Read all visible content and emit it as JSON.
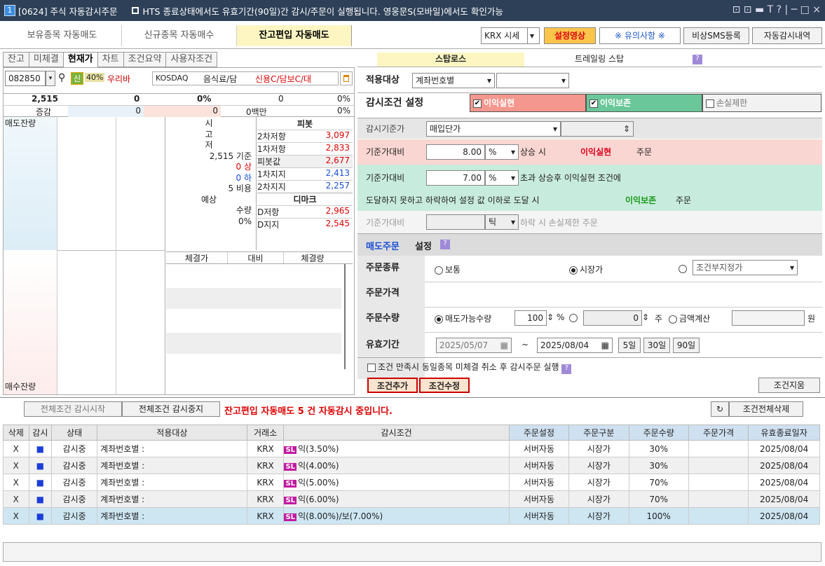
{
  "title": {
    "num": "1",
    "text": "[0624] 주식 자동감시주문",
    "notice": "HTS 종료상태에서도 유효기간(90일)간 감시/주문이 실행됩니다. 영웅문S(모바일)에서도 확인가능",
    "controls": "⊡ ⊡ ▬ T ? | ─ □ ×"
  },
  "toptabs": [
    "보유종목 자동매도",
    "신규종목 자동매수",
    "잔고편입 자동매도"
  ],
  "topright": {
    "market": "KRX 시세",
    "setting_video": "설정영상",
    "caution": "※ 유의사항 ※",
    "sms": "비상SMS등록",
    "history": "자동감시내역"
  },
  "lefttabs": [
    "잔고",
    "미체결",
    "현재가",
    "차트",
    "조건요약",
    "사용자조건"
  ],
  "stock": {
    "code": "082850",
    "badge": "신",
    "rate": "40%",
    "name": "우리바",
    "market": "KOSDAQ",
    "sector": "음식료/담",
    "credit": "신용C/담보C/대"
  },
  "quote": {
    "price": "2,515",
    "change_label": "증감",
    "v1": "0",
    "v2": "0%",
    "v3": "0",
    "v4": "0%",
    "r2a": "0",
    "r2b": "0",
    "r2c": "0백만",
    "r2d": "0%"
  },
  "orderbook": {
    "sell_label": "매도잔량",
    "buy_label": "매수잔량",
    "mid": [
      "시",
      "고",
      "저",
      "2,515 기준",
      "0 상",
      "0 하",
      "5 비용",
      "예상",
      "수량",
      "0%"
    ],
    "pivot_title": "피봇",
    "pivot": [
      [
        "2차저항",
        "3,097"
      ],
      [
        "1차저항",
        "2,833"
      ],
      [
        "피봇값",
        "2,677"
      ],
      [
        "1차지지",
        "2,413"
      ],
      [
        "2차지지",
        "2,257"
      ]
    ],
    "dimark_title": "디마크",
    "dimark": [
      [
        "D저항",
        "2,965"
      ],
      [
        "D지지",
        "2,545"
      ]
    ],
    "trade_cols": [
      "체결가",
      "대비",
      "체결량"
    ]
  },
  "righttabs": [
    "스탑로스",
    "트레일링 스탑"
  ],
  "apply": {
    "label": "적용대상",
    "value": "계좌번호별"
  },
  "cond": {
    "label": "감시조건 설정",
    "c1": "이익실현",
    "c2": "이익보존",
    "c3": "손실제한"
  },
  "base": {
    "label": "감시기준가",
    "value": "매입단가"
  },
  "r1": {
    "label": "기준가대비",
    "value": "8.00",
    "unit": "%",
    "text1": "상승 시",
    "text2": "이익실현",
    "text3": "주문"
  },
  "r2": {
    "label": "기준가대비",
    "value": "7.00",
    "unit": "%",
    "text1": "초과 상승후 이익실현 조건에",
    "line2a": "도달하지 못하고 하락하여 설정 값 이하로 도달 시",
    "line2b": "이익보존",
    "line2c": "주문"
  },
  "r3": {
    "label": "기준가대비",
    "unit": "틱",
    "text": "하락 시 손실제한 주문"
  },
  "sellorder": {
    "title_a": "매도주문",
    "title_b": "설정"
  },
  "ordertype": {
    "label": "주문종류",
    "o1": "보통",
    "o2": "시장가",
    "o3": "조건부지정가"
  },
  "orderprice": {
    "label": "주문가격"
  },
  "qty": {
    "label": "주문수량",
    "q1": "매도가능수량",
    "q1v": "100",
    "q1u": "%",
    "q2v": "0",
    "q2u": "주",
    "q3": "금액계산",
    "q3u": "원"
  },
  "valid": {
    "label": "유효기간",
    "from": "2025/05/07",
    "to": "2025/08/04",
    "b1": "5일",
    "b2": "30일",
    "b3": "90일"
  },
  "cancel_opt": "조건 만족시 동일종목 미체결 취소 후 감시주문 실행",
  "btns": {
    "add": "조건추가",
    "edit": "조건수정",
    "clear": "조건지움",
    "start": "전체조건 감시시작",
    "stop": "전체조건 감시중지",
    "delall": "조건전체삭제"
  },
  "status_msg": "잔고편입 자동매도 5 건 자동감시 중입니다.",
  "table": {
    "headers": [
      "삭제",
      "감시",
      "상태",
      "적용대상",
      "거래소",
      "감시조건",
      "주문설정",
      "주문구분",
      "주문수량",
      "주문가격",
      "유효종료일자"
    ],
    "rows": [
      [
        "X",
        "■",
        "감시중",
        "계좌번호별 :",
        "KRX",
        "익(3.50%)",
        "서버자동",
        "시장가",
        "30%",
        "",
        "2025/08/04"
      ],
      [
        "X",
        "■",
        "감시중",
        "계좌번호별 :",
        "KRX",
        "익(4.00%)",
        "서버자동",
        "시장가",
        "30%",
        "",
        "2025/08/04"
      ],
      [
        "X",
        "■",
        "감시중",
        "계좌번호별 :",
        "KRX",
        "익(5.00%)",
        "서버자동",
        "시장가",
        "70%",
        "",
        "2025/08/04"
      ],
      [
        "X",
        "■",
        "감시중",
        "계좌번호별 :",
        "KRX",
        "익(6.00%)",
        "서버자동",
        "시장가",
        "70%",
        "",
        "2025/08/04"
      ],
      [
        "X",
        "■",
        "감시중",
        "계좌번호별 :",
        "KRX",
        "익(8.00%)/보(7.00%)",
        "서버자동",
        "시장가",
        "100%",
        "",
        "2025/08/04"
      ]
    ],
    "sl": "SL"
  },
  "colors": {
    "accent": "#fdf6c3",
    "profit": "#f9d6d2",
    "keep": "#c7ebdc"
  }
}
